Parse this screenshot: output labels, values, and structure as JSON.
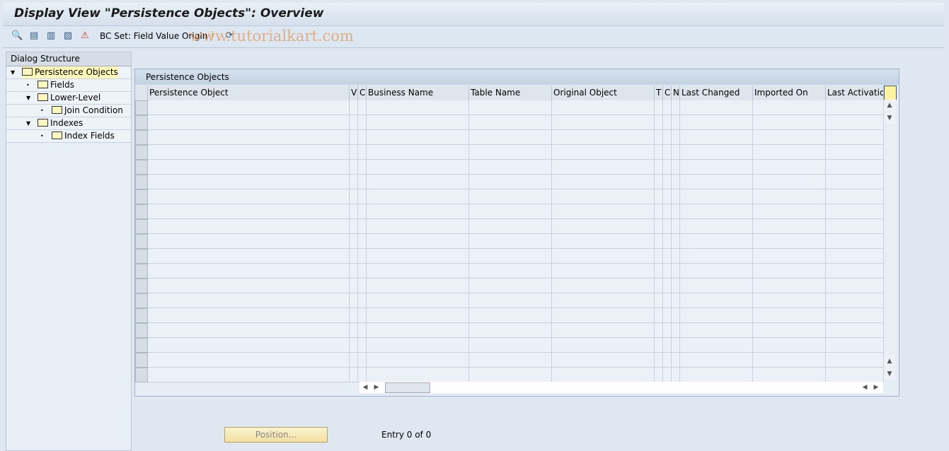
{
  "title": "Display View \"Persistence Objects\": Overview",
  "toolbar": {
    "icons": [
      "find-icon",
      "select-all-icon",
      "select-block-icon",
      "deselect-all-icon",
      "print-icon"
    ],
    "bc_set_label": "BC Set: Field Value Origin"
  },
  "watermark": "www.tutorialkart.com",
  "dialog_structure": {
    "header": "Dialog Structure",
    "items": [
      {
        "label": "Persistence Objects",
        "level": 0,
        "expanded": true,
        "selected": true
      },
      {
        "label": "Fields",
        "level": 1
      },
      {
        "label": "Lower-Level",
        "level": 1,
        "expanded": true
      },
      {
        "label": "Join Condition",
        "level": 2
      },
      {
        "label": "Indexes",
        "level": 1,
        "expanded": true
      },
      {
        "label": "Index Fields",
        "level": 2
      }
    ]
  },
  "table": {
    "title": "Persistence Objects",
    "columns": [
      "Persistence Object",
      "V",
      "C",
      "Business Name",
      "Table Name",
      "Original Object",
      "T",
      "C",
      "N",
      "Last Changed",
      "Imported On",
      "Last Activation"
    ],
    "rows": []
  },
  "footer": {
    "position_button": "Position...",
    "entry_text": "Entry 0 of 0"
  }
}
